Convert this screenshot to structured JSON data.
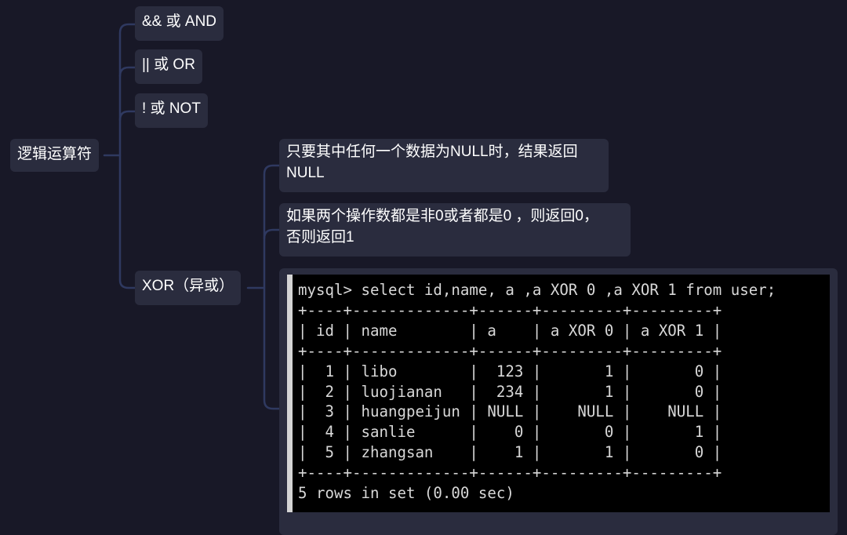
{
  "mindmap": {
    "root": "逻辑运算符",
    "branches": [
      {
        "label": "&& 或 AND"
      },
      {
        "label": "|| 或 OR"
      },
      {
        "label": "! 或 NOT"
      },
      {
        "label": "XOR（异或）"
      }
    ],
    "xor_notes": [
      {
        "line1": "只要其中任何一个数据为NULL时，结果返回",
        "line2": "NULL"
      },
      {
        "line1": "如果两个操作数都是非0或者都是0 ，则返回0，",
        "line2": "否则返回1"
      }
    ]
  },
  "terminal": {
    "lines": [
      "mysql> select id,name, a ,a XOR 0 ,a XOR 1 from user;",
      "+----+-------------+------+---------+---------+",
      "| id | name        | a    | a XOR 0 | a XOR 1 |",
      "+----+-------------+------+---------+---------+",
      "|  1 | libo        |  123 |       1 |       0 |",
      "|  2 | luojianan   |  234 |       1 |       0 |",
      "|  3 | huangpeijun | NULL |    NULL |    NULL |",
      "|  4 | sanlie      |    0 |       0 |       1 |",
      "|  5 | zhangsan    |    1 |       1 |       0 |",
      "+----+-------------+------+---------+---------+",
      "5 rows in set (0.00 sec)"
    ]
  },
  "colors": {
    "background": "#181827",
    "node": "#2a2c3e",
    "connector": "#2f3960",
    "text": "#ffffff"
  }
}
